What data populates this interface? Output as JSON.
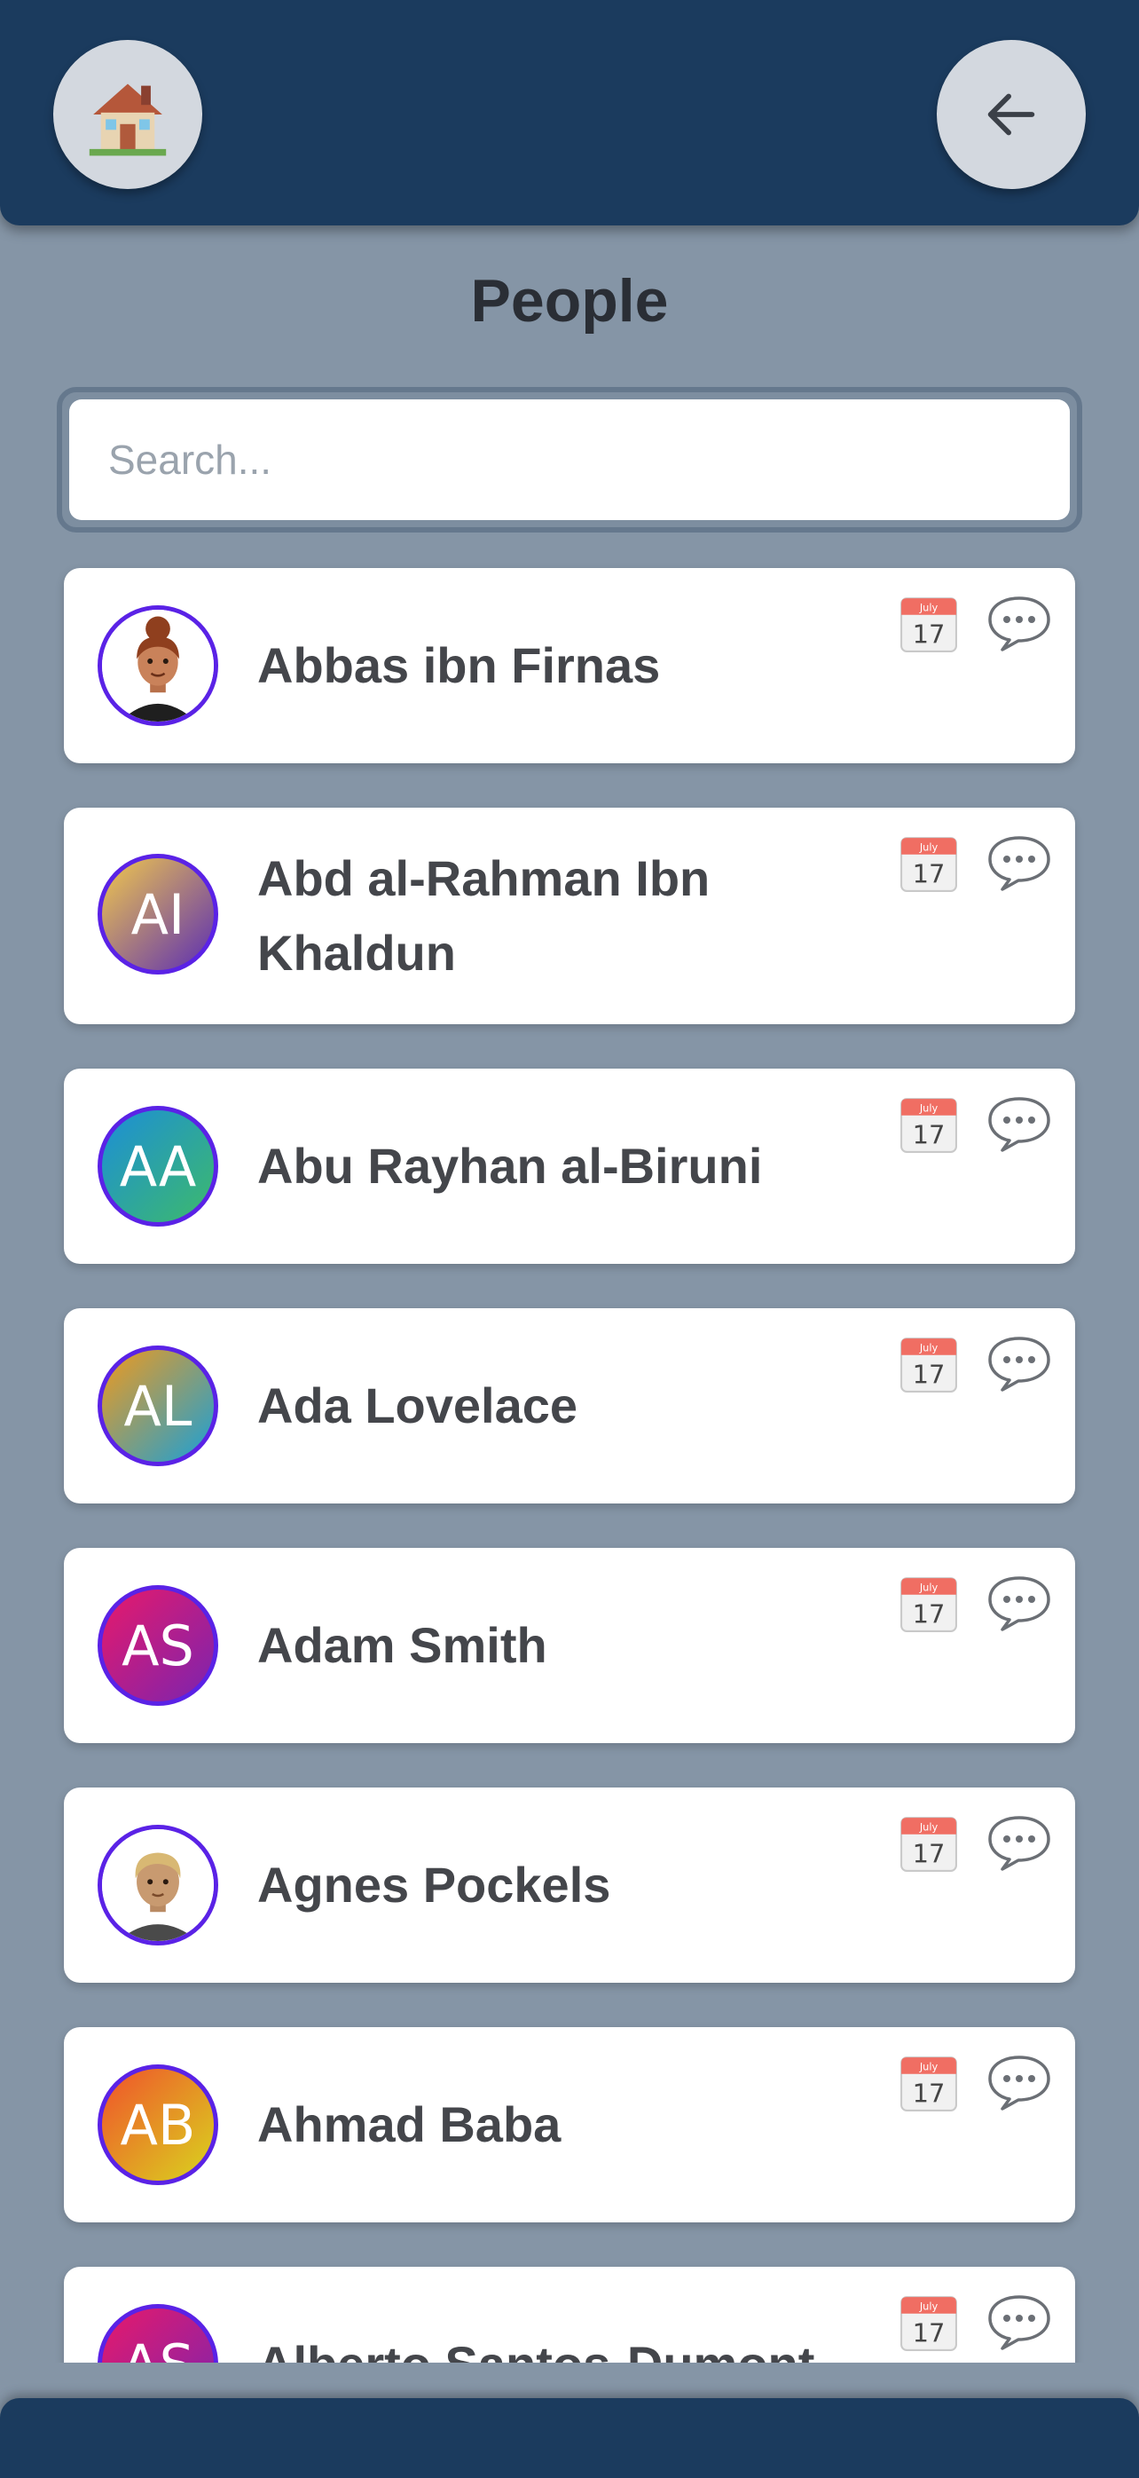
{
  "header": {
    "home_icon": "house-emoji-icon",
    "back_icon": "arrow-left-icon"
  },
  "page": {
    "title": "People"
  },
  "search": {
    "placeholder": "Search..."
  },
  "calendar_icon_text": {
    "month": "July",
    "day": "17"
  },
  "people": [
    {
      "name": "Abbas ibn Firnas",
      "avatar_type": "cartoon-woman-bun-icon"
    },
    {
      "name": "Abd al-Rahman Ibn Khaldun",
      "initials": "AI",
      "gradient": [
        "#f2c94c",
        "#5b2db3"
      ]
    },
    {
      "name": "Abu Rayhan al-Biruni",
      "initials": "AA",
      "gradient": [
        "#1c8ed8",
        "#3dba6b"
      ]
    },
    {
      "name": "Ada Lovelace",
      "initials": "AL",
      "gradient": [
        "#f19a1c",
        "#19a0d8"
      ]
    },
    {
      "name": "Adam Smith",
      "initials": "AS",
      "gradient": [
        "#e8196a",
        "#7a24b0"
      ]
    },
    {
      "name": "Agnes Pockels",
      "avatar_type": "cartoon-man-blond-icon"
    },
    {
      "name": "Ahmad Baba",
      "initials": "AB",
      "gradient": [
        "#f0512b",
        "#d9d51e"
      ]
    },
    {
      "name": "Alberto Santos-Dumont",
      "initials": "AS",
      "gradient": [
        "#e8196a",
        "#7a24b0"
      ]
    }
  ],
  "colors": {
    "header_bg": "#1b3b5e",
    "page_bg": "#8595a6",
    "avatar_ring": "#5a22e6"
  }
}
